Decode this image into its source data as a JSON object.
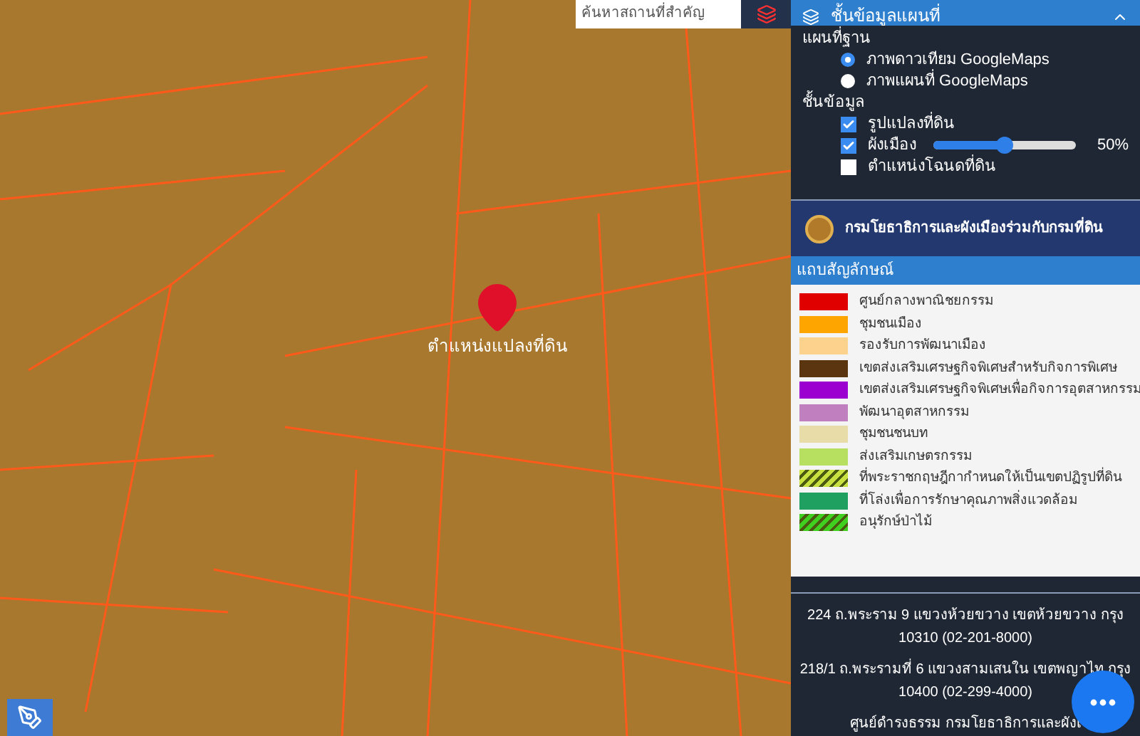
{
  "search": {
    "placeholder": "ค้นหาสถานที่สำคัญ"
  },
  "map": {
    "marker_label": "ตำแหน่งแปลงที่ดิน"
  },
  "panel": {
    "title": "ชั้นข้อมูลแผนที่",
    "base_map": {
      "heading": "แผนที่ฐาน",
      "options": [
        {
          "label": "ภาพดาวเทียม GoogleMaps",
          "selected": true
        },
        {
          "label": "ภาพแผนที่ GoogleMaps",
          "selected": false
        }
      ]
    },
    "layers": {
      "heading": "ชั้นข้อมูล",
      "items": [
        {
          "kind": "check",
          "label": "รูปแปลงที่ดิน",
          "checked": true
        },
        {
          "kind": "slider",
          "label": "ผังเมือง",
          "checked": true,
          "level": 0.5,
          "reading": "50%"
        },
        {
          "kind": "check",
          "label": "ตำแหน่งโฉนดที่ดิน",
          "checked": false
        }
      ]
    },
    "department": "กรมโยธาธิการและผังเมืองร่วมกับกรมที่ดิน",
    "legend": {
      "heading": "แถบสัญลักษณ์",
      "items": [
        {
          "label": "ศูนย์กลางพาณิชยกรรม",
          "color": "#e00000",
          "kind": "solid"
        },
        {
          "label": "ชุมชนเมือง",
          "color": "#ffa500",
          "kind": "solid"
        },
        {
          "label": "รองรับการพัฒนาเมือง",
          "color": "#fcd28c",
          "kind": "solid"
        },
        {
          "label": "เขตส่งเสริมเศรษฐกิจพิเศษสำหรับกิจการพิเศษ",
          "color": "#5a3510",
          "kind": "solid"
        },
        {
          "label": "เขตส่งเสริมเศรษฐกิจพิเศษเพื่อกิจการอุตสาหกรรม",
          "color": "#9b00d0",
          "kind": "solid"
        },
        {
          "label": "พัฒนาอุตสาหกรรม",
          "color": "#c080c0",
          "kind": "solid"
        },
        {
          "label": "ชุมชนชนบท",
          "color": "#e8dca8",
          "kind": "solid"
        },
        {
          "label": "ส่งเสริมเกษตรกรรม",
          "color": "#b8e060",
          "kind": "solid"
        },
        {
          "label": "ที่พระราชกฤษฎีกากำหนดให้เป็นเขตปฏิรูปที่ดิน",
          "color": "#c8e040",
          "kind": "hatched"
        },
        {
          "label": "ที่โล่งเพื่อการรักษาคุณภาพสิ่งแวดล้อม",
          "color": "#20a060",
          "kind": "solid"
        },
        {
          "label": "อนุรักษ์ป่าไม้",
          "color": "#40d020",
          "kind": "hatched"
        }
      ]
    },
    "footer": [
      "224 ถ.พระราม 9 แขวงห้วยขวาง เขตห้วยขวาง กรุง",
      "10310 (02-201-8000)",
      "218/1 ถ.พระรามที่ 6 แขวงสามเสนใน เขตพญาไท กรุง",
      "10400 (02-299-4000)",
      "ศูนย์ดำรงธรรม กรมโยธาธิการและผังเ"
    ]
  }
}
